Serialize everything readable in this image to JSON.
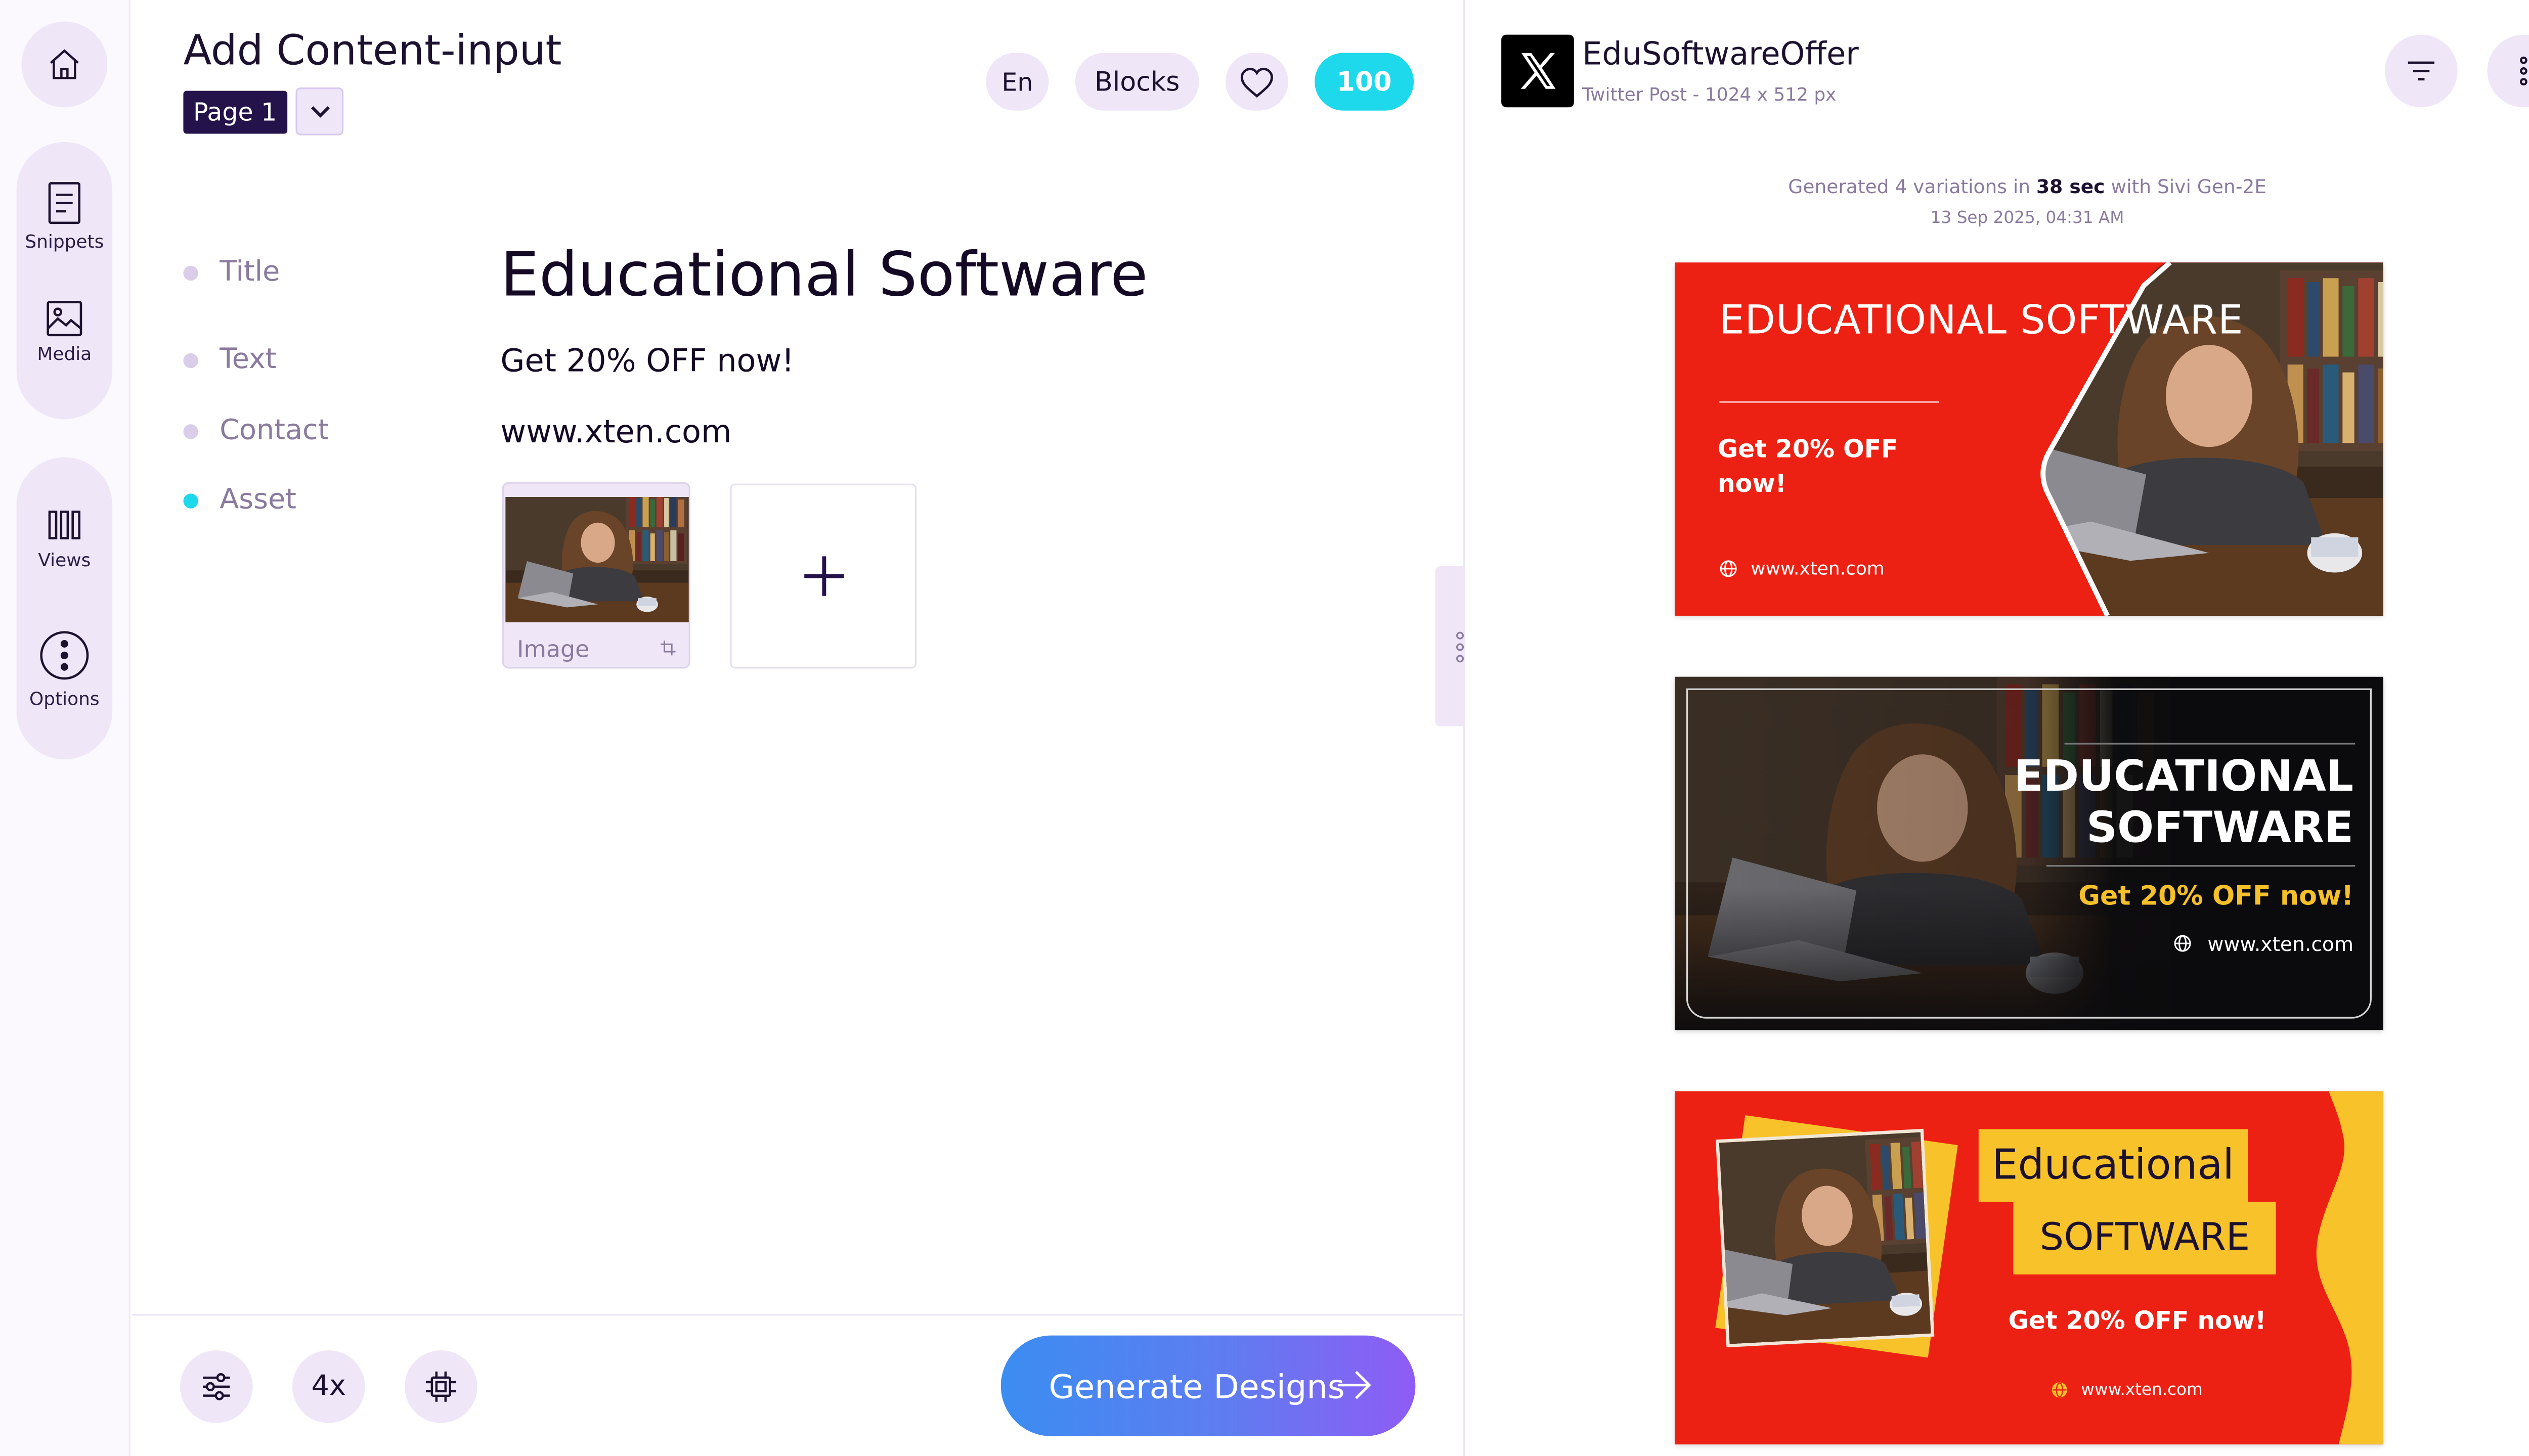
{
  "rail": {
    "items": [
      {
        "label": "Snippets",
        "icon": "document-icon"
      },
      {
        "label": "Media",
        "icon": "image-icon"
      },
      {
        "label": "Views",
        "icon": "views-icon"
      },
      {
        "label": "Options",
        "icon": "options-icon"
      }
    ]
  },
  "header": {
    "title": "Add Content-input",
    "page_label": "Page 1",
    "lang": "En",
    "blocks": "Blocks",
    "credits": "100"
  },
  "fields": [
    {
      "label": "Title",
      "value": "Educational Software"
    },
    {
      "label": "Text",
      "value": "Get 20% OFF now!"
    },
    {
      "label": "Contact",
      "value": "www.xten.com"
    },
    {
      "label": "Asset"
    }
  ],
  "asset": {
    "name": "Image"
  },
  "footer": {
    "count": "4x",
    "generate_label": "Generate Designs"
  },
  "right": {
    "project_name": "EduSoftwareOffer",
    "format": "Twitter Post - 1024 x 512 px",
    "gen_prefix": "Generated 4 variations in",
    "gen_time": "38 sec",
    "gen_suffix": "with Sivi Gen-2E",
    "date": "13 Sep 2025, 04:31 AM"
  },
  "designs": [
    {
      "title": "EDUCATIONAL SOFTWARE",
      "offer": "Get 20% OFF now!",
      "web": "www.xten.com"
    },
    {
      "title": "EDUCATIONAL SOFTWARE",
      "offer": "Get 20% OFF now!",
      "web": "www.xten.com"
    },
    {
      "title_1": "Educational",
      "title_2": "SOFTWARE",
      "offer": "Get 20% OFF now!",
      "web": "www.xten.com"
    }
  ],
  "colors": {
    "accent": "#efe7f8",
    "credits": "#1ed8ec",
    "navy": "#24124a",
    "design_red": "#ec2113",
    "design_yellow": "#f8c22a"
  }
}
